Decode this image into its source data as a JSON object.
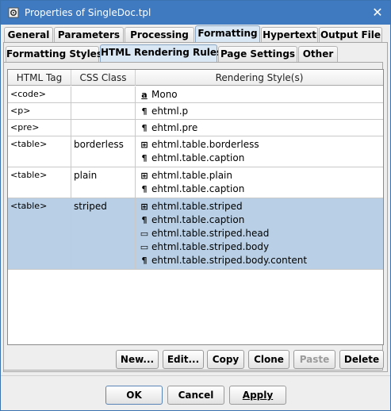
{
  "window": {
    "title": "Properties of SingleDoc.tpl",
    "app_icon": "gear-document-icon",
    "close_icon": "close-icon"
  },
  "tabs_main": [
    {
      "label": "General",
      "active": false
    },
    {
      "label": "Parameters",
      "active": false
    },
    {
      "label": "Processing",
      "active": false
    },
    {
      "label": "Formatting",
      "active": true
    },
    {
      "label": "Hypertext",
      "active": false
    },
    {
      "label": "Output File",
      "active": false
    }
  ],
  "tabs_sub": [
    {
      "label": "Formatting Styles",
      "active": false
    },
    {
      "label": "HTML Rendering Rules",
      "active": true
    },
    {
      "label": "Page Settings",
      "active": false
    },
    {
      "label": "Other",
      "active": false
    }
  ],
  "table": {
    "headers": [
      "HTML Tag",
      "CSS Class",
      "Rendering Style(s)"
    ],
    "rows": [
      {
        "tag": "<code>",
        "css": "",
        "selected": false,
        "styles": [
          {
            "icon": "character-style-icon",
            "glyph": "a",
            "name": "Mono"
          }
        ]
      },
      {
        "tag": "<p>",
        "css": "",
        "selected": false,
        "styles": [
          {
            "icon": "paragraph-style-icon",
            "glyph": "¶",
            "name": "ehtml.p"
          }
        ]
      },
      {
        "tag": "<pre>",
        "css": "",
        "selected": false,
        "styles": [
          {
            "icon": "paragraph-style-icon",
            "glyph": "¶",
            "name": "ehtml.pre"
          }
        ]
      },
      {
        "tag": "<table>",
        "css": "borderless",
        "selected": false,
        "styles": [
          {
            "icon": "table-style-icon",
            "glyph": "⊞",
            "name": "ehtml.table.borderless"
          },
          {
            "icon": "paragraph-style-icon",
            "glyph": "¶",
            "name": "ehtml.table.caption"
          }
        ]
      },
      {
        "tag": "<table>",
        "css": "plain",
        "selected": false,
        "styles": [
          {
            "icon": "table-style-icon",
            "glyph": "⊞",
            "name": "ehtml.table.plain"
          },
          {
            "icon": "paragraph-style-icon",
            "glyph": "¶",
            "name": "ehtml.table.caption"
          }
        ]
      },
      {
        "tag": "<table>",
        "css": "striped",
        "selected": true,
        "styles": [
          {
            "icon": "table-style-icon",
            "glyph": "⊞",
            "name": "ehtml.table.striped"
          },
          {
            "icon": "paragraph-style-icon",
            "glyph": "¶",
            "name": "ehtml.table.caption"
          },
          {
            "icon": "row-style-icon",
            "glyph": "▭",
            "name": "ehtml.table.striped.head"
          },
          {
            "icon": "row-style-icon",
            "glyph": "▭",
            "name": "ehtml.table.striped.body"
          },
          {
            "icon": "paragraph-style-icon",
            "glyph": "¶",
            "name": "ehtml.table.striped.body.content"
          }
        ]
      }
    ]
  },
  "table_buttons": [
    {
      "label": "New...",
      "enabled": true
    },
    {
      "label": "Edit...",
      "enabled": true
    },
    {
      "label": "Copy",
      "enabled": true
    },
    {
      "label": "Clone",
      "enabled": true
    },
    {
      "label": "Paste",
      "enabled": false
    },
    {
      "label": "Delete",
      "enabled": true
    }
  ],
  "dialog_buttons": [
    {
      "label": "OK"
    },
    {
      "label": "Cancel"
    },
    {
      "label": "Apply"
    }
  ],
  "colors": {
    "titlebar": "#3f7ac0",
    "selected_row": "#b8cfe5",
    "active_tab": "#d9e6f4"
  }
}
